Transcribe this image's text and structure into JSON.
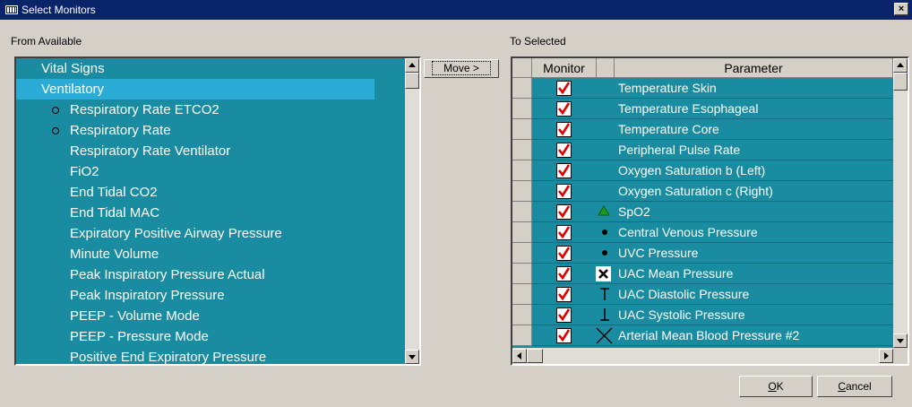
{
  "window": {
    "title": "Select Monitors",
    "close_glyph": "×"
  },
  "left": {
    "label": "From Available",
    "items": [
      {
        "label": "Vital Signs",
        "indent": 0,
        "bullet": false,
        "selected": false
      },
      {
        "label": "Ventilatory",
        "indent": 0,
        "bullet": false,
        "selected": true
      },
      {
        "label": "Respiratory Rate ETCO2",
        "indent": 1,
        "bullet": true,
        "selected": false
      },
      {
        "label": "Respiratory Rate",
        "indent": 1,
        "bullet": true,
        "selected": false
      },
      {
        "label": "Respiratory Rate Ventilator",
        "indent": 1,
        "bullet": false,
        "selected": false
      },
      {
        "label": "FiO2",
        "indent": 1,
        "bullet": false,
        "selected": false
      },
      {
        "label": "End Tidal CO2",
        "indent": 1,
        "bullet": false,
        "selected": false
      },
      {
        "label": "End Tidal MAC",
        "indent": 1,
        "bullet": false,
        "selected": false
      },
      {
        "label": "Expiratory Positive Airway Pressure",
        "indent": 1,
        "bullet": false,
        "selected": false
      },
      {
        "label": "Minute Volume",
        "indent": 1,
        "bullet": false,
        "selected": false
      },
      {
        "label": "Peak Inspiratory Pressure Actual",
        "indent": 1,
        "bullet": false,
        "selected": false
      },
      {
        "label": "Peak Inspiratory Pressure",
        "indent": 1,
        "bullet": false,
        "selected": false
      },
      {
        "label": "PEEP - Volume Mode",
        "indent": 1,
        "bullet": false,
        "selected": false
      },
      {
        "label": "PEEP - Pressure Mode",
        "indent": 1,
        "bullet": false,
        "selected": false
      },
      {
        "label": "Positive End Expiratory Pressure",
        "indent": 1,
        "bullet": false,
        "selected": false
      }
    ]
  },
  "move_button": "Move >",
  "right": {
    "label": "To Selected",
    "columns": {
      "monitor": "Monitor",
      "parameter": "Parameter"
    },
    "rows": [
      {
        "parameter": "Temperature Skin",
        "checked": true,
        "symbol": "none"
      },
      {
        "parameter": "Temperature Esophageal",
        "checked": true,
        "symbol": "none"
      },
      {
        "parameter": "Temperature Core",
        "checked": true,
        "symbol": "none"
      },
      {
        "parameter": "Peripheral Pulse Rate",
        "checked": true,
        "symbol": "none"
      },
      {
        "parameter": "Oxygen Saturation b (Left)",
        "checked": true,
        "symbol": "none"
      },
      {
        "parameter": "Oxygen Saturation c (Right)",
        "checked": true,
        "symbol": "none"
      },
      {
        "parameter": "SpO2",
        "checked": true,
        "symbol": "green-triangle-icon"
      },
      {
        "parameter": "Central Venous Pressure",
        "checked": true,
        "symbol": "dot-icon"
      },
      {
        "parameter": "UVC Pressure",
        "checked": true,
        "symbol": "dot-icon"
      },
      {
        "parameter": "UAC Mean Pressure",
        "checked": true,
        "symbol": "boxed-x-icon"
      },
      {
        "parameter": "UAC Diastolic Pressure",
        "checked": true,
        "symbol": "t-bar-down-icon"
      },
      {
        "parameter": "UAC Systolic Pressure",
        "checked": true,
        "symbol": "t-bar-up-icon"
      },
      {
        "parameter": "Arterial Mean Blood Pressure #2",
        "checked": true,
        "symbol": "x-cross-icon"
      }
    ]
  },
  "buttons": {
    "ok": "OK",
    "cancel": "Cancel"
  },
  "colors": {
    "list_bg": "#1a8ca1",
    "selected_bg": "#2bacd6",
    "titlebar": "#0a246a",
    "check": "#e00000",
    "spo2": "#1a9a1a"
  }
}
